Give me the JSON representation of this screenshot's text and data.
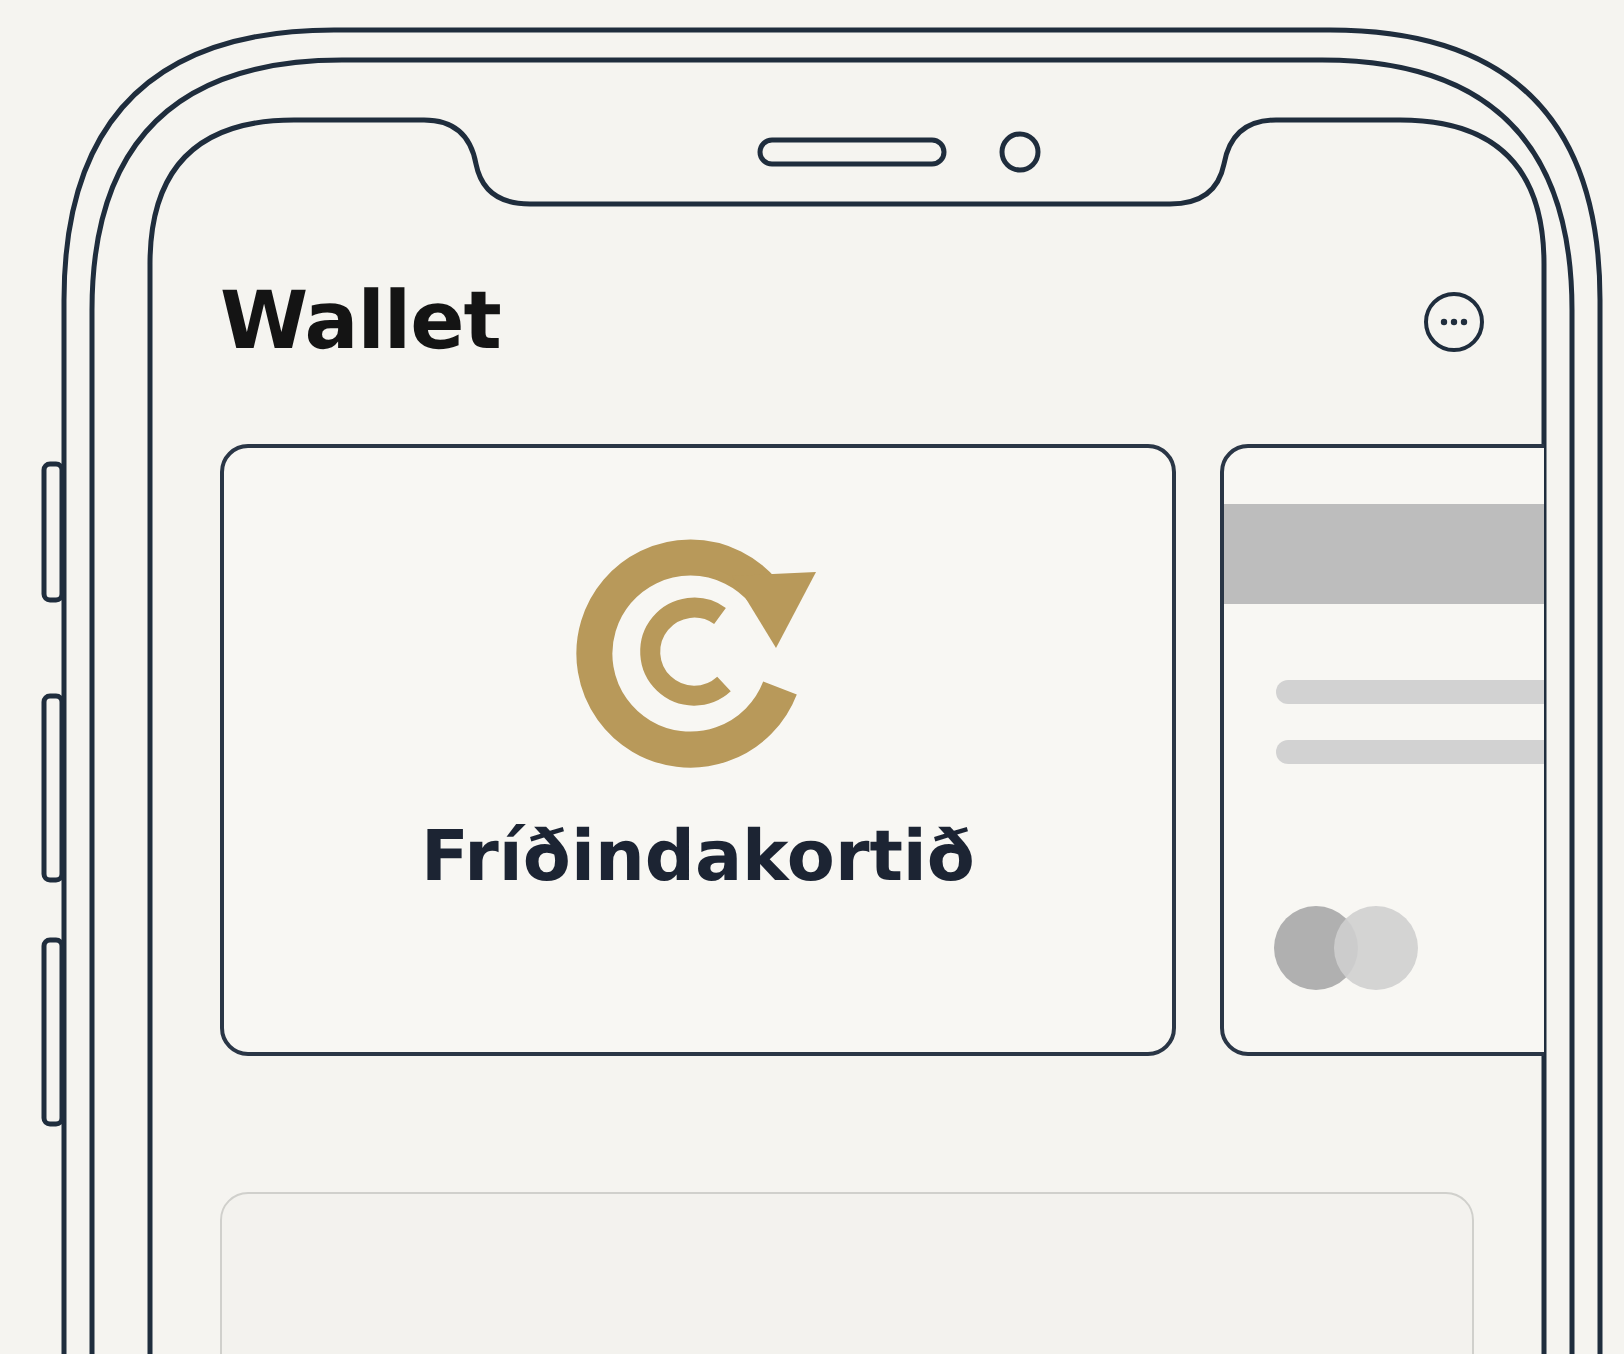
{
  "header": {
    "title": "Wallet"
  },
  "cards": [
    {
      "kind": "loyalty",
      "name": "Fríðindakortið"
    },
    {
      "kind": "bank"
    }
  ]
}
